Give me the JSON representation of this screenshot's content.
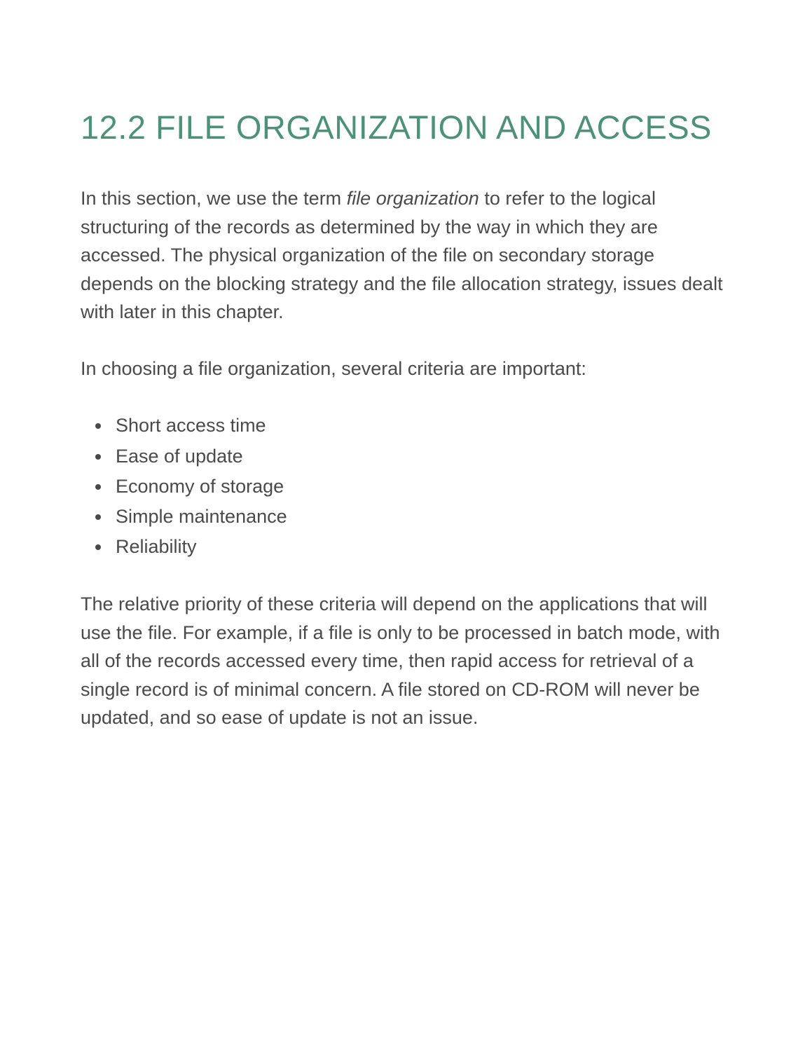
{
  "heading": "12.2 FILE ORGANIZATION AND ACCESS",
  "paragraph1_pre": "In this section, we use the term ",
  "paragraph1_italic": "file organization",
  "paragraph1_post": " to refer to the logical structuring of the records as determined by the way in which they are accessed. The physical organization of the file on secondary storage depends on the blocking strategy and the file allocation strategy, issues dealt with later in this chapter.",
  "paragraph2": "In choosing a file organization, several criteria are important:",
  "bullets": [
    "Short access time",
    "Ease of update",
    "Economy of storage",
    "Simple maintenance",
    "Reliability"
  ],
  "paragraph3": "The relative priority of these criteria will depend on the applications that will use the file. For example, if a file is only to be processed in batch mode, with all of the records accessed every time, then rapid access for retrieval of a single record is of minimal concern. A file stored on CD-ROM will never be updated, and so ease of update is not an issue."
}
